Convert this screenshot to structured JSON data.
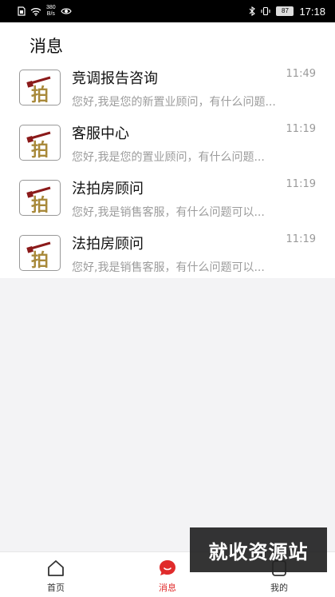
{
  "status_bar": {
    "speed_value": "380",
    "speed_unit": "B/s",
    "battery": "87",
    "time": "17:18"
  },
  "page": {
    "title": "消息"
  },
  "messages": [
    {
      "name": "竞调报告咨询",
      "time": "11:49",
      "preview": "您好,我是您的新置业顾问，有什么问题..."
    },
    {
      "name": "客服中心",
      "time": "11:19",
      "preview": "您好,我是您的置业顾问，有什么问题..."
    },
    {
      "name": "法拍房顾问",
      "time": "11:19",
      "preview": "您好,我是销售客服，有什么问题可以..."
    },
    {
      "name": "法拍房顾问",
      "time": "11:19",
      "preview": "您好,我是销售客服，有什么问题可以..."
    }
  ],
  "avatar_glyph": "拍",
  "tabs": [
    {
      "label": "首页",
      "icon": "home-icon",
      "active": false
    },
    {
      "label": "消息",
      "icon": "message-icon",
      "active": true
    },
    {
      "label": "我的",
      "icon": "profile-icon",
      "active": false
    }
  ],
  "watermark": "就收资源站",
  "colors": {
    "accent": "#e02b2b",
    "avatar_gold": "#a8893a",
    "avatar_red": "#8b1a1a"
  }
}
